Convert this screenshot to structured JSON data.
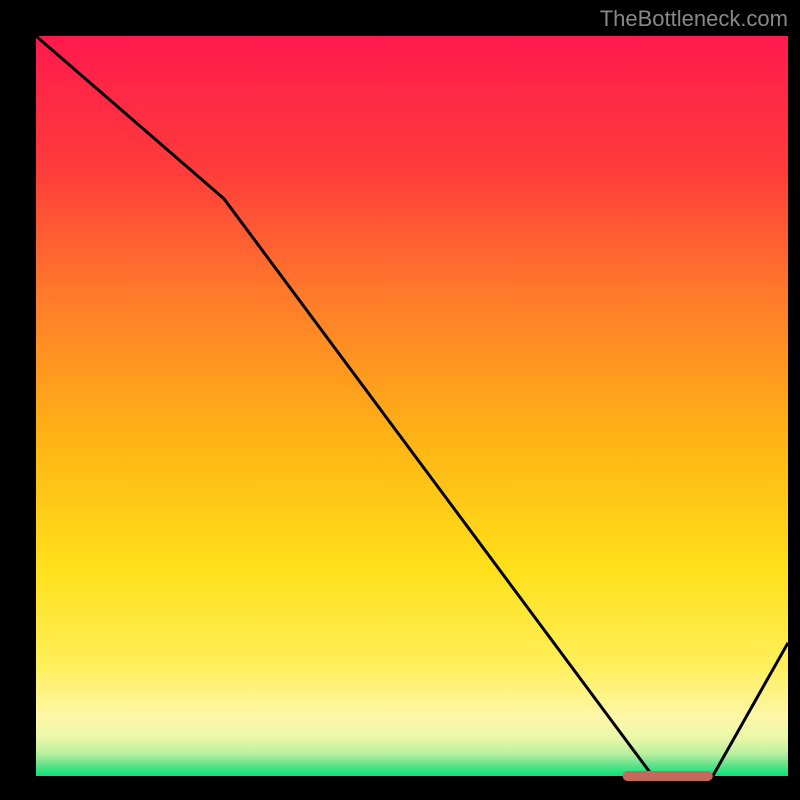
{
  "source_label": "TheBottleneck.com",
  "colors": {
    "red": "#ff1744",
    "yellow": "#ffeb3b",
    "yellow_light": "#fff59d",
    "green": "#00e676",
    "line": "#000000",
    "marker": "#c46a5a"
  },
  "plot": {
    "x_range": [
      0,
      100
    ],
    "y_range": [
      0,
      100
    ]
  },
  "chart_data": {
    "type": "line",
    "title": "",
    "xlabel": "",
    "ylabel": "",
    "x": [
      0,
      25,
      82,
      90,
      100
    ],
    "values": [
      100,
      78,
      0,
      0,
      18
    ],
    "marker": {
      "x_start": 78,
      "x_end": 90,
      "y": 0
    },
    "xlim": [
      0,
      100
    ],
    "ylim": [
      0,
      100
    ]
  }
}
